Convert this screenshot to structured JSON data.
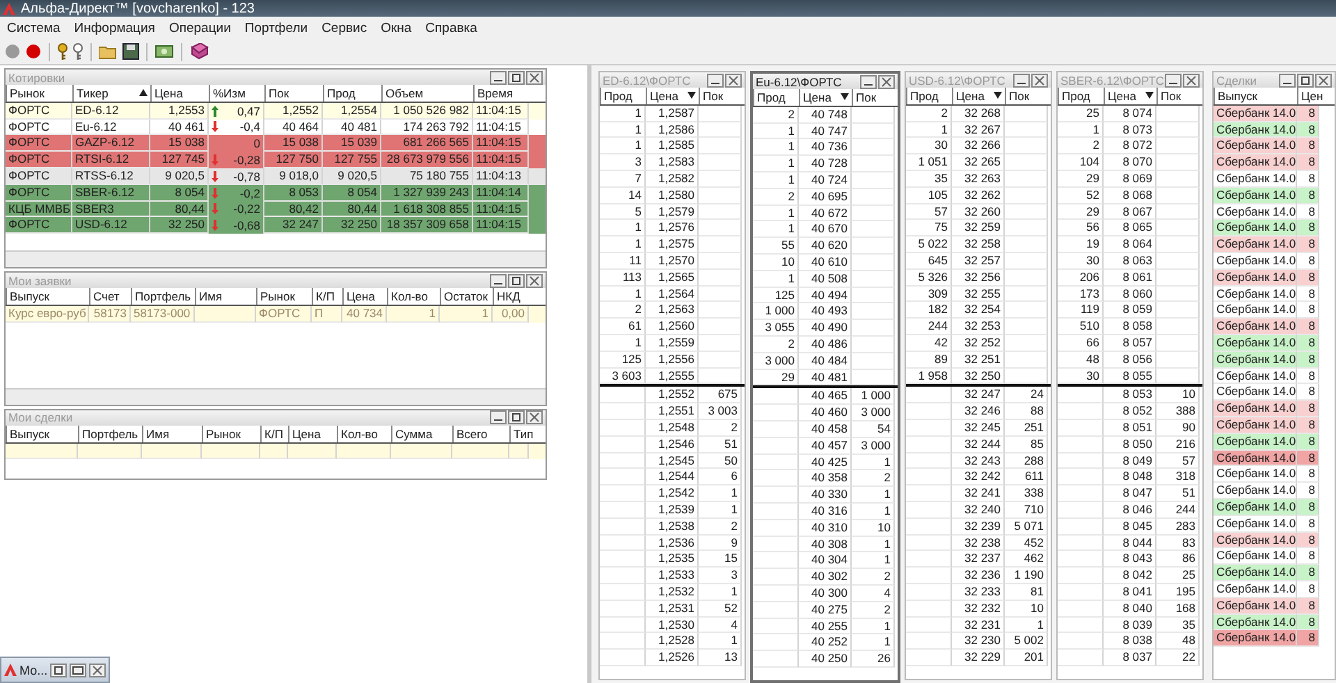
{
  "window": {
    "title": "Альфа-Директ™ [vovcharenko] - 123"
  },
  "menu": [
    "Система",
    "Информация",
    "Операции",
    "Портфели",
    "Сервис",
    "Окна",
    "Справка"
  ],
  "quotes": {
    "title": "Котировки",
    "descending": false,
    "columns": [
      {
        "label": "Рынок",
        "sorted": false
      },
      {
        "label": "Тикер",
        "sorted": true
      },
      {
        "label": "Цена",
        "sorted": false
      },
      {
        "label": "%Изм",
        "sorted": false
      },
      {
        "label": "Пок",
        "sorted": false
      },
      {
        "label": "Прод",
        "sorted": false
      },
      {
        "label": "Объем",
        "sorted": false
      },
      {
        "label": "Время",
        "sorted": false
      }
    ],
    "rows": [
      {
        "color": "#fffde2",
        "kind": "up",
        "cells": [
          "ФОРТС",
          "ED-6.12",
          "1,2553",
          "0,47",
          "1,2552",
          "1,2554",
          "1 050 526 982",
          "11:04:15"
        ]
      },
      {
        "color": "#ffffff",
        "kind": "down",
        "cells": [
          "ФОРТС",
          "Eu-6.12",
          "40 461",
          "-0,4",
          "40 464",
          "40 481",
          "174 263 792",
          "11:04:15"
        ]
      },
      {
        "color": "#e07474",
        "kind": "flat",
        "cells": [
          "ФОРТС",
          "GAZP-6.12",
          "15 038",
          "0",
          "15 038",
          "15 039",
          "681 266 565",
          "11:04:15"
        ]
      },
      {
        "color": "#e07474",
        "kind": "down",
        "cells": [
          "ФОРТС",
          "RTSI-6.12",
          "127 745",
          "-0,28",
          "127 750",
          "127 755",
          "28 673 979 556",
          "11:04:15"
        ]
      },
      {
        "color": "#e6e6e6",
        "kind": "down",
        "cells": [
          "ФОРТС",
          "RTSS-6.12",
          "9 020,5",
          "-0,78",
          "9 018,0",
          "9 020,5",
          "75 180 755",
          "11:04:13"
        ]
      },
      {
        "color": "#6fa56f",
        "kind": "down",
        "cells": [
          "ФОРТС",
          "SBER-6.12",
          "8 054",
          "-0,2",
          "8 053",
          "8 054",
          "1 327 939 243",
          "11:04:14"
        ]
      },
      {
        "color": "#6fa56f",
        "kind": "down",
        "cells": [
          "КЦБ ММВБ",
          "SBER3",
          "80,44",
          "-0,22",
          "80,42",
          "80,44",
          "1 618 308 855",
          "11:04:15"
        ]
      },
      {
        "color": "#6fa56f",
        "kind": "down",
        "cells": [
          "ФОРТС",
          "USD-6.12",
          "32 250",
          "-0,68",
          "32 247",
          "32 250",
          "18 357 309 658",
          "11:04:15"
        ]
      }
    ]
  },
  "orders": {
    "title": "Мои заявки",
    "columns": [
      "Выпуск",
      "Счет",
      "Портфель",
      "Имя",
      "Рынок",
      "К/П",
      "Цена",
      "Кол-во",
      "Остаток",
      "НКД"
    ],
    "rows": [
      {
        "cells": [
          "Курс евро-руб",
          "58173",
          "58173-000",
          "",
          "ФОРТС",
          "П",
          "40 734",
          "1",
          "1",
          "0,00"
        ]
      }
    ]
  },
  "deals": {
    "title": "Мои сделки",
    "columns": [
      "Выпуск",
      "Портфель",
      "Имя",
      "Рынок",
      "К/П",
      "Цена",
      "Кол-во",
      "Сумма",
      "Всего",
      "Тип"
    ]
  },
  "books": [
    {
      "title": "ED-6.12\\ФОРТС",
      "active": false,
      "descending": true,
      "columns": [
        {
          "label": "Прод",
          "sorted": false
        },
        {
          "label": "Цена",
          "sorted": true
        },
        {
          "label": "Пок",
          "sorted": false
        }
      ],
      "asks": [
        [
          "1",
          "1,2587"
        ],
        [
          "1",
          "1,2586"
        ],
        [
          "1",
          "1,2585"
        ],
        [
          "3",
          "1,2583"
        ],
        [
          "7",
          "1,2582"
        ],
        [
          "14",
          "1,2580"
        ],
        [
          "5",
          "1,2579"
        ],
        [
          "1",
          "1,2576"
        ],
        [
          "1",
          "1,2575"
        ],
        [
          "11",
          "1,2570"
        ],
        [
          "113",
          "1,2565"
        ],
        [
          "1",
          "1,2564"
        ],
        [
          "2",
          "1,2563"
        ],
        [
          "61",
          "1,2560"
        ],
        [
          "1",
          "1,2559"
        ],
        [
          "125",
          "1,2556"
        ],
        [
          "3 603",
          "1,2555"
        ]
      ],
      "bids": [
        [
          "1,2552",
          "675"
        ],
        [
          "1,2551",
          "3 003"
        ],
        [
          "1,2548",
          "2"
        ],
        [
          "1,2546",
          "51"
        ],
        [
          "1,2545",
          "50"
        ],
        [
          "1,2544",
          "6"
        ],
        [
          "1,2542",
          "1"
        ],
        [
          "1,2539",
          "1"
        ],
        [
          "1,2538",
          "2"
        ],
        [
          "1,2536",
          "9"
        ],
        [
          "1,2535",
          "15"
        ],
        [
          "1,2533",
          "3"
        ],
        [
          "1,2532",
          "1"
        ],
        [
          "1,2531",
          "52"
        ],
        [
          "1,2530",
          "4"
        ],
        [
          "1,2528",
          "1"
        ],
        [
          "1,2526",
          "13"
        ]
      ]
    },
    {
      "title": "Eu-6.12\\ФОРТС",
      "active": true,
      "descending": true,
      "columns": [
        {
          "label": "Прод",
          "sorted": false
        },
        {
          "label": "Цена",
          "sorted": true
        },
        {
          "label": "Пок",
          "sorted": false
        }
      ],
      "asks": [
        [
          "2",
          "40 748"
        ],
        [
          "1",
          "40 747"
        ],
        [
          "1",
          "40 736"
        ],
        [
          "1",
          "40 728"
        ],
        [
          "1",
          "40 724"
        ],
        [
          "2",
          "40 695"
        ],
        [
          "1",
          "40 672"
        ],
        [
          "1",
          "40 670"
        ],
        [
          "55",
          "40 620"
        ],
        [
          "10",
          "40 610"
        ],
        [
          "1",
          "40 508"
        ],
        [
          "125",
          "40 494"
        ],
        [
          "1 000",
          "40 493"
        ],
        [
          "3 055",
          "40 490"
        ],
        [
          "2",
          "40 486"
        ],
        [
          "3 000",
          "40 484"
        ],
        [
          "29",
          "40 481"
        ]
      ],
      "bids": [
        [
          "40 465",
          "1 000"
        ],
        [
          "40 460",
          "3 000"
        ],
        [
          "40 458",
          "54"
        ],
        [
          "40 457",
          "3 000"
        ],
        [
          "40 425",
          "1"
        ],
        [
          "40 358",
          "2"
        ],
        [
          "40 330",
          "1"
        ],
        [
          "40 316",
          "1"
        ],
        [
          "40 310",
          "10"
        ],
        [
          "40 308",
          "1"
        ],
        [
          "40 304",
          "1"
        ],
        [
          "40 302",
          "2"
        ],
        [
          "40 300",
          "4"
        ],
        [
          "40 275",
          "2"
        ],
        [
          "40 255",
          "1"
        ],
        [
          "40 252",
          "1"
        ],
        [
          "40 250",
          "26"
        ]
      ]
    },
    {
      "title": "USD-6.12\\ФОРТС",
      "active": false,
      "descending": true,
      "columns": [
        {
          "label": "Прод",
          "sorted": false
        },
        {
          "label": "Цена",
          "sorted": true
        },
        {
          "label": "Пок",
          "sorted": false
        }
      ],
      "asks": [
        [
          "2",
          "32 268"
        ],
        [
          "1",
          "32 267"
        ],
        [
          "30",
          "32 266"
        ],
        [
          "1 051",
          "32 265"
        ],
        [
          "35",
          "32 263"
        ],
        [
          "105",
          "32 262"
        ],
        [
          "57",
          "32 260"
        ],
        [
          "75",
          "32 259"
        ],
        [
          "5 022",
          "32 258"
        ],
        [
          "645",
          "32 257"
        ],
        [
          "5 326",
          "32 256"
        ],
        [
          "309",
          "32 255"
        ],
        [
          "182",
          "32 254"
        ],
        [
          "244",
          "32 253"
        ],
        [
          "42",
          "32 252"
        ],
        [
          "89",
          "32 251"
        ],
        [
          "1 958",
          "32 250"
        ]
      ],
      "bids": [
        [
          "32 247",
          "24"
        ],
        [
          "32 246",
          "88"
        ],
        [
          "32 245",
          "251"
        ],
        [
          "32 244",
          "85"
        ],
        [
          "32 243",
          "288"
        ],
        [
          "32 242",
          "611"
        ],
        [
          "32 241",
          "338"
        ],
        [
          "32 240",
          "710"
        ],
        [
          "32 239",
          "5 071"
        ],
        [
          "32 238",
          "452"
        ],
        [
          "32 237",
          "462"
        ],
        [
          "32 236",
          "1 190"
        ],
        [
          "32 233",
          "81"
        ],
        [
          "32 232",
          "10"
        ],
        [
          "32 231",
          "1"
        ],
        [
          "32 230",
          "5 002"
        ],
        [
          "32 229",
          "201"
        ]
      ]
    },
    {
      "title": "SBER-6.12\\ФОРТС",
      "active": false,
      "descending": true,
      "columns": [
        {
          "label": "Прод",
          "sorted": false
        },
        {
          "label": "Цена",
          "sorted": true
        },
        {
          "label": "Пок",
          "sorted": false
        }
      ],
      "asks": [
        [
          "25",
          "8 074"
        ],
        [
          "1",
          "8 073"
        ],
        [
          "2",
          "8 072"
        ],
        [
          "104",
          "8 070"
        ],
        [
          "29",
          "8 069"
        ],
        [
          "52",
          "8 068"
        ],
        [
          "29",
          "8 067"
        ],
        [
          "56",
          "8 065"
        ],
        [
          "19",
          "8 064"
        ],
        [
          "30",
          "8 063"
        ],
        [
          "206",
          "8 061"
        ],
        [
          "173",
          "8 060"
        ],
        [
          "119",
          "8 059"
        ],
        [
          "510",
          "8 058"
        ],
        [
          "66",
          "8 057"
        ],
        [
          "48",
          "8 056"
        ],
        [
          "30",
          "8 055"
        ]
      ],
      "bids": [
        [
          "8 053",
          "10"
        ],
        [
          "8 052",
          "388"
        ],
        [
          "8 051",
          "90"
        ],
        [
          "8 050",
          "216"
        ],
        [
          "8 049",
          "57"
        ],
        [
          "8 048",
          "318"
        ],
        [
          "8 047",
          "51"
        ],
        [
          "8 046",
          "244"
        ],
        [
          "8 045",
          "283"
        ],
        [
          "8 044",
          "83"
        ],
        [
          "8 043",
          "86"
        ],
        [
          "8 042",
          "25"
        ],
        [
          "8 041",
          "195"
        ],
        [
          "8 040",
          "168"
        ],
        [
          "8 039",
          "35"
        ],
        [
          "8 038",
          "48"
        ],
        [
          "8 037",
          "22"
        ]
      ]
    }
  ],
  "trades": {
    "title": "Сделки",
    "columns": [
      "Выпуск",
      "Цен"
    ],
    "rows": [
      {
        "issue": "Сбербанк 14.0",
        "price": "8",
        "color": "#f8d0d0"
      },
      {
        "issue": "Сбербанк 14.0",
        "price": "8",
        "color": "#c8f2c8"
      },
      {
        "issue": "Сбербанк 14.0",
        "price": "8",
        "color": "#f8d0d0"
      },
      {
        "issue": "Сбербанк 14.0",
        "price": "8",
        "color": "#f8d0d0"
      },
      {
        "issue": "Сбербанк 14.0",
        "price": "8",
        "color": "#ffffff"
      },
      {
        "issue": "Сбербанк 14.0",
        "price": "8",
        "color": "#c8f2c8"
      },
      {
        "issue": "Сбербанк 14.0",
        "price": "8",
        "color": "#ffffff"
      },
      {
        "issue": "Сбербанк 14.0",
        "price": "8",
        "color": "#c8f2c8"
      },
      {
        "issue": "Сбербанк 14.0",
        "price": "8",
        "color": "#f8d0d0"
      },
      {
        "issue": "Сбербанк 14.0",
        "price": "8",
        "color": "#ffffff"
      },
      {
        "issue": "Сбербанк 14.0",
        "price": "8",
        "color": "#f8d0d0"
      },
      {
        "issue": "Сбербанк 14.0",
        "price": "8",
        "color": "#ffffff"
      },
      {
        "issue": "Сбербанк 14.0",
        "price": "8",
        "color": "#ffffff"
      },
      {
        "issue": "Сбербанк 14.0",
        "price": "8",
        "color": "#f8d0d0"
      },
      {
        "issue": "Сбербанк 14.0",
        "price": "8",
        "color": "#c8f2c8"
      },
      {
        "issue": "Сбербанк 14.0",
        "price": "8",
        "color": "#c8f2c8"
      },
      {
        "issue": "Сбербанк 14.0",
        "price": "8",
        "color": "#ffffff"
      },
      {
        "issue": "Сбербанк 14.0",
        "price": "8",
        "color": "#ffffff"
      },
      {
        "issue": "Сбербанк 14.0",
        "price": "8",
        "color": "#f8d0d0"
      },
      {
        "issue": "Сбербанк 14.0",
        "price": "8",
        "color": "#f8d0d0"
      },
      {
        "issue": "Сбербанк 14.0",
        "price": "8",
        "color": "#c8f2c8"
      },
      {
        "issue": "Сбербанк 14.0",
        "price": "8",
        "color": "#f0a4a4"
      },
      {
        "issue": "Сбербанк 14.0",
        "price": "8",
        "color": "#ffffff"
      },
      {
        "issue": "Сбербанк 14.0",
        "price": "8",
        "color": "#ffffff"
      },
      {
        "issue": "Сбербанк 14.0",
        "price": "8",
        "color": "#c8f2c8"
      },
      {
        "issue": "Сбербанк 14.0",
        "price": "8",
        "color": "#ffffff"
      },
      {
        "issue": "Сбербанк 14.0",
        "price": "8",
        "color": "#f8d0d0"
      },
      {
        "issue": "Сбербанк 14.0",
        "price": "8",
        "color": "#ffffff"
      },
      {
        "issue": "Сбербанк 14.0",
        "price": "8",
        "color": "#c8f2c8"
      },
      {
        "issue": "Сбербанк 14.0",
        "price": "8",
        "color": "#ffffff"
      },
      {
        "issue": "Сбербанк 14.0",
        "price": "8",
        "color": "#f8d0d0"
      },
      {
        "issue": "Сбербанк 14.0",
        "price": "8",
        "color": "#c8f2c8"
      },
      {
        "issue": "Сбербанк 14.0",
        "price": "8",
        "color": "#f0a4a4"
      }
    ]
  },
  "taskbar": {
    "label": "Мо..."
  }
}
